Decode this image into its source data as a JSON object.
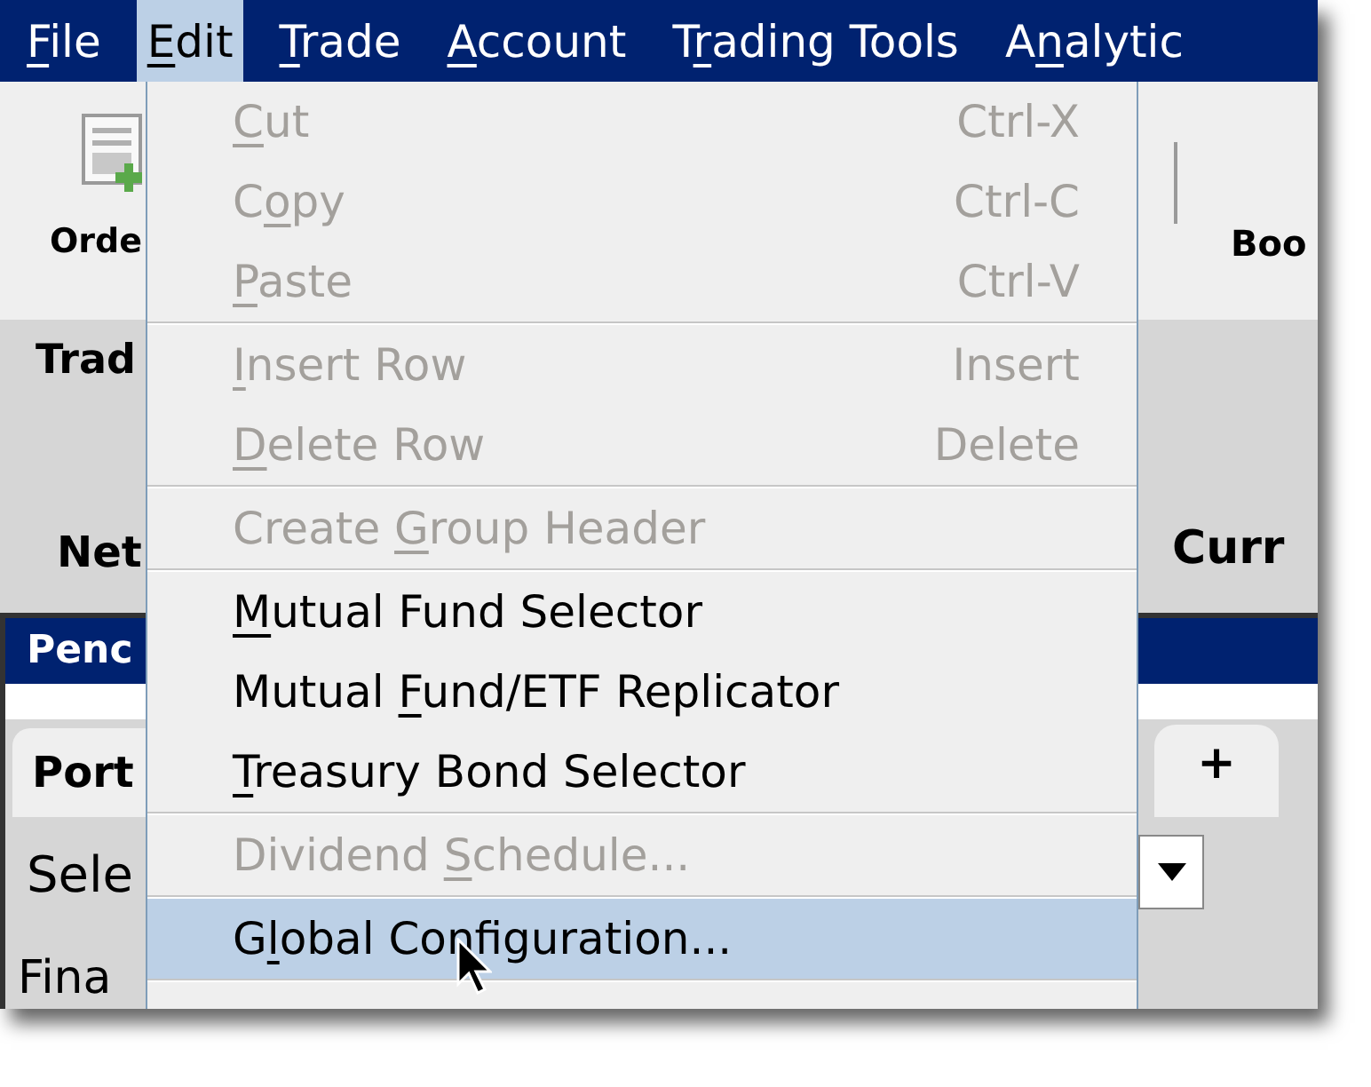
{
  "menu_bar": [
    {
      "label": {
        "key": "F",
        "post": "ile"
      },
      "selected": false
    },
    {
      "label": {
        "key": "E",
        "post": "dit"
      },
      "selected": true
    },
    {
      "label": {
        "key": "T",
        "post": "rade"
      },
      "selected": false
    },
    {
      "label": {
        "key": "A",
        "post": "ccount"
      },
      "selected": false
    },
    {
      "label": {
        "pre": "T",
        "key": "r",
        "post": "ading Tools"
      },
      "selected": false
    },
    {
      "label": {
        "pre": "A",
        "key": "n",
        "post": "alytic"
      },
      "selected": false
    }
  ],
  "edit_menu": [
    [
      {
        "label": {
          "key": "C",
          "post": "ut"
        },
        "shortcut": "Ctrl-X",
        "disabled": true,
        "selected": false
      },
      {
        "label": {
          "pre": "C",
          "key": "o",
          "post": "py"
        },
        "shortcut": "Ctrl-C",
        "disabled": true,
        "selected": false
      },
      {
        "label": {
          "key": "P",
          "post": "aste"
        },
        "shortcut": "Ctrl-V",
        "disabled": true,
        "selected": false
      }
    ],
    [
      {
        "label": {
          "key": "I",
          "post": "nsert Row"
        },
        "shortcut": "Insert",
        "disabled": true,
        "selected": false
      },
      {
        "label": {
          "key": "D",
          "post": "elete Row"
        },
        "shortcut": "Delete",
        "disabled": true,
        "selected": false
      }
    ],
    [
      {
        "label": {
          "pre": "Create ",
          "key": "G",
          "post": "roup Header"
        },
        "disabled": true,
        "selected": false
      }
    ],
    [
      {
        "label": {
          "key": "M",
          "post": "utual Fund Selector"
        },
        "disabled": false,
        "selected": false
      },
      {
        "label": {
          "pre": "Mutual ",
          "key": "F",
          "post": "und/ETF Replicator"
        },
        "disabled": false,
        "selected": false
      },
      {
        "label": {
          "key": "T",
          "post": "reasury Bond Selector"
        },
        "disabled": false,
        "selected": false
      }
    ],
    [
      {
        "label": {
          "pre": "Dividend ",
          "key": "S",
          "post": "chedule..."
        },
        "disabled": true,
        "selected": false
      }
    ],
    [
      {
        "label": {
          "pre": "G",
          "key": "l",
          "post": "obal Configuration..."
        },
        "disabled": false,
        "selected": true
      }
    ]
  ],
  "background": {
    "toolbar_left": "Orde",
    "toolbar_right": "Boo",
    "panel_label": "Trad",
    "net_label": "Net",
    "currency_label": "Curr",
    "pane_title": "Penc",
    "tab_left": "Port",
    "tab_add": "+",
    "select_label": "Sele",
    "bottom_label": "Fina"
  }
}
